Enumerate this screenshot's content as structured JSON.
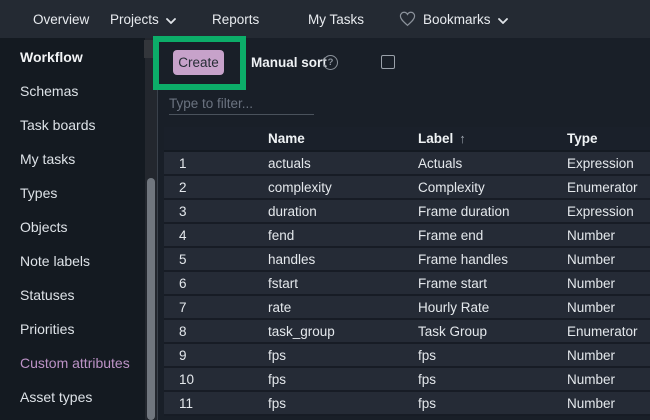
{
  "nav": {
    "items": [
      {
        "label": "Overview",
        "caret": false,
        "icon": null
      },
      {
        "label": "Projects",
        "caret": true,
        "icon": null
      },
      {
        "label": "Reports",
        "caret": false,
        "icon": null
      },
      {
        "label": "My Tasks",
        "caret": false,
        "icon": null
      },
      {
        "label": "Bookmarks",
        "caret": true,
        "icon": "heart-icon"
      }
    ]
  },
  "sidebar": {
    "items": [
      {
        "label": "Workflow",
        "bold": true,
        "active": false
      },
      {
        "label": "Schemas",
        "bold": false,
        "active": false
      },
      {
        "label": "Task boards",
        "bold": false,
        "active": false
      },
      {
        "label": "My tasks",
        "bold": false,
        "active": false
      },
      {
        "label": "Types",
        "bold": false,
        "active": false
      },
      {
        "label": "Objects",
        "bold": false,
        "active": false
      },
      {
        "label": "Note labels",
        "bold": false,
        "active": false
      },
      {
        "label": "Statuses",
        "bold": false,
        "active": false
      },
      {
        "label": "Priorities",
        "bold": false,
        "active": false
      },
      {
        "label": "Custom attributes",
        "bold": false,
        "active": true
      },
      {
        "label": "Asset types",
        "bold": false,
        "active": false
      }
    ],
    "active_color": "#bd93c7"
  },
  "toolbar": {
    "create_label": "Create",
    "manual_sort_label": "Manual sort",
    "help_glyph": "?",
    "checkbox_checked": false
  },
  "filter": {
    "placeholder": "Type to filter..."
  },
  "table": {
    "columns": [
      "",
      "Name",
      "Label",
      "Type"
    ],
    "sort_column": "Label",
    "sort_direction": "asc",
    "sort_indicator": "↑",
    "rows": [
      {
        "num": "1",
        "name": "actuals",
        "label": "Actuals",
        "type": "Expression"
      },
      {
        "num": "2",
        "name": "complexity",
        "label": "Complexity",
        "type": "Enumerator"
      },
      {
        "num": "3",
        "name": "duration",
        "label": "Frame duration",
        "type": "Expression"
      },
      {
        "num": "4",
        "name": "fend",
        "label": "Frame end",
        "type": "Number"
      },
      {
        "num": "5",
        "name": "handles",
        "label": "Frame handles",
        "type": "Number"
      },
      {
        "num": "6",
        "name": "fstart",
        "label": "Frame start",
        "type": "Number"
      },
      {
        "num": "7",
        "name": "rate",
        "label": "Hourly Rate",
        "type": "Number"
      },
      {
        "num": "8",
        "name": "task_group",
        "label": "Task Group",
        "type": "Enumerator"
      },
      {
        "num": "9",
        "name": "fps",
        "label": "fps",
        "type": "Number"
      },
      {
        "num": "10",
        "name": "fps",
        "label": "fps",
        "type": "Number"
      },
      {
        "num": "11",
        "name": "fps",
        "label": "fps",
        "type": "Number"
      }
    ]
  },
  "annotation": {
    "type": "highlight-box",
    "target": "create-button",
    "color": "#0cad69"
  },
  "colors": {
    "nav_bg": "#242a33",
    "sidebar_bg": "#141a21",
    "content_bg": "#191f28",
    "row_bg": "#252b36",
    "header_bg": "#1a202a",
    "create_btn_bg": "#c7a2ca",
    "accent_green": "#0cad69",
    "active_lavender": "#bd93c7"
  }
}
